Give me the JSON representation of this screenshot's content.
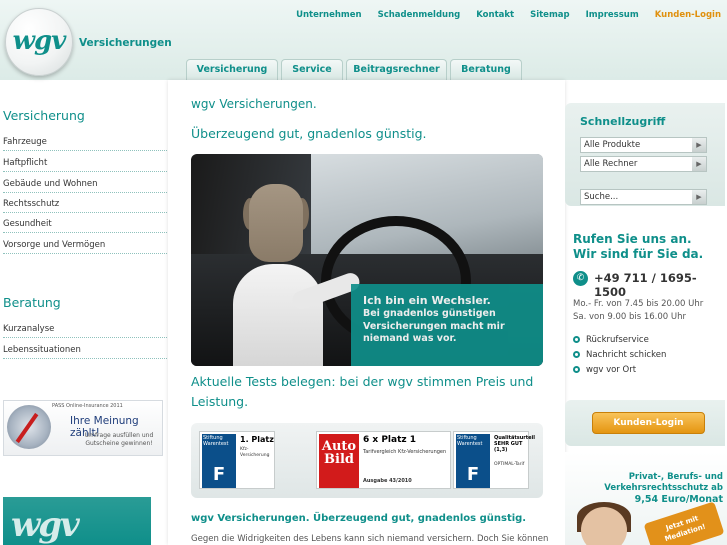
{
  "brand": {
    "logo_text": "wgv",
    "sub": "Versicherungen",
    "colors": {
      "primary": "#0f8f8a",
      "accent": "#e49511"
    }
  },
  "topnav": [
    "Unternehmen",
    "Schadenmeldung",
    "Kontakt",
    "Sitemap",
    "Impressum",
    "Kunden-Login"
  ],
  "tabs": [
    "Versicherung",
    "Service",
    "Beitragsrechner",
    "Beratung"
  ],
  "leftnav": {
    "section1": "Versicherung",
    "items1": [
      "Fahrzeuge",
      "Haftpflicht",
      "Gebäude und Wohnen",
      "Rechtsschutz",
      "Gesundheit",
      "Vorsorge und Vermögen"
    ],
    "section2": "Beratung",
    "items2": [
      "Kurzanalyse",
      "Lebenssituationen"
    ]
  },
  "main": {
    "title1": "wgv Versicherungen.",
    "title2": "Überzeugend gut, gnadenlos günstig.",
    "hero_big": "Ich bin ein Wechsler.",
    "hero_small": "Bei gnadenlos günstigen Versicherungen macht mir niemand was vor.",
    "tests_heading": "Aktuelle Tests belegen: bei der wgv stimmen Preis und Leistung.",
    "bottom_heading": "wgv Versicherungen. Überzeugend gut, gnadenlos günstig.",
    "bottom_text": "Gegen die Widrigkeiten des Lebens kann sich niemand versichern. Doch Sie können"
  },
  "awards": {
    "badge1": {
      "org": "Stiftung Warentest",
      "logo": "Finanztest",
      "rank": "1. Platz",
      "desc": "Kfz-Versicherung",
      "edition": "Ausgabe 11/2010"
    },
    "autobild": {
      "logo": "Auto Bild",
      "rank": "6 x Platz 1",
      "desc": "Tarifvergleich Kfz-Versicherungen",
      "edition": "Ausgabe 43/2010"
    },
    "badge2": {
      "org": "Stiftung Warentest",
      "logo": "Finanztest",
      "rank": "Qualitätsurteil SEHR GUT (1,3)",
      "desc": "OPTIMAL-Tarif",
      "edition": "Ausgabe 04/2010"
    }
  },
  "quickaccess": {
    "title": "Schnellzugriff",
    "select1": "Alle Produkte",
    "select2": "Alle Rechner",
    "search_placeholder": "Suche..."
  },
  "contact": {
    "heading1": "Rufen Sie uns an.",
    "heading2": "Wir sind für Sie da.",
    "phone": "+49 711 / 1695-1500",
    "hours1": "Mo.- Fr. von 7.45 bis 20.00 Uhr",
    "hours2": "Sa. von 9.00 bis 16.00 Uhr",
    "links": [
      "Rückrufservice",
      "Nachricht schicken",
      "wgv vor Ort"
    ]
  },
  "login_button": "Kunden-Login",
  "promo": {
    "line1": "Privat-, Berufs- und",
    "line2": "Verkehrsrechtsschutz ab",
    "price": "9,54 Euro/Monat",
    "star": "Jetzt mit Mediation!"
  },
  "banner1": {
    "top": "PASS Online-Insurance 2011",
    "main": "Ihre Meinung zählt!",
    "sub": "Umfrage ausfüllen und Gutscheine gewinnen!"
  },
  "banner2": {
    "text": "wgv"
  }
}
